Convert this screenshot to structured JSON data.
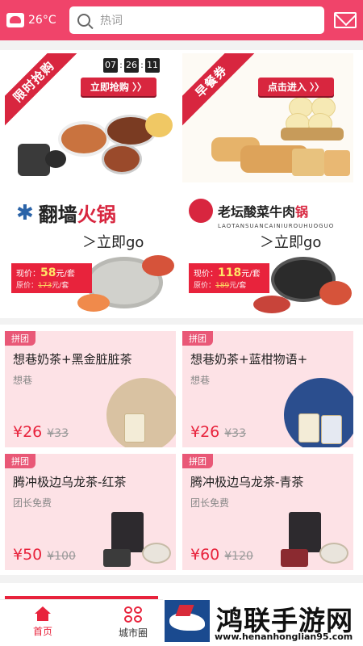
{
  "header": {
    "temperature": "26°C",
    "search_placeholder": "热词"
  },
  "banners": {
    "flash": {
      "ribbon": "限时抢购",
      "countdown": [
        "07",
        "26",
        "11"
      ],
      "button": "立即抢购 〉〉"
    },
    "breakfast": {
      "ribbon": "早餐券",
      "button": "点击进入 〉〉"
    },
    "hotpot1": {
      "brand": "翻墙",
      "brand_red": "火锅",
      "go": "＞立即go",
      "now_label": "现价：",
      "now_price": "58",
      "now_unit": "元/套",
      "old_label": "原价：",
      "old_price": "173",
      "old_unit": "元/套"
    },
    "hotpot2": {
      "brand": "老坛酸菜牛肉",
      "brand_red": "锅",
      "brand_sub": "LAOTANSUANCAINIUROUHUOGUO",
      "go": "＞立即go",
      "now_label": "现价：",
      "now_price": "118",
      "now_unit": "元/套",
      "old_label": "原价：",
      "old_price": "189",
      "old_unit": "元/套"
    }
  },
  "products": [
    {
      "badge": "拼团",
      "name": "想巷奶茶+黑金脏脏茶",
      "shop": "想巷",
      "price": "¥26",
      "old_price": "¥33"
    },
    {
      "badge": "拼团",
      "name": "想巷奶茶+蓝柑物语+",
      "shop": "想巷",
      "price": "¥26",
      "old_price": "¥33"
    },
    {
      "badge": "拼团",
      "name": "腾冲极边乌龙茶-红茶",
      "shop": "团长免费",
      "price": "¥50",
      "old_price": "¥100"
    },
    {
      "badge": "拼团",
      "name": "腾冲极边乌龙茶-青茶",
      "shop": "团长免费",
      "price": "¥60",
      "old_price": "¥120"
    }
  ],
  "nav": {
    "home": "首页",
    "city": "城市圈"
  },
  "watermark": {
    "title": "鸿联手游网",
    "url": "www.henanhonglian95.com"
  },
  "colors": {
    "accent": "#f0446a",
    "price_red": "#e8233c",
    "card_bg": "#fde2e6"
  }
}
